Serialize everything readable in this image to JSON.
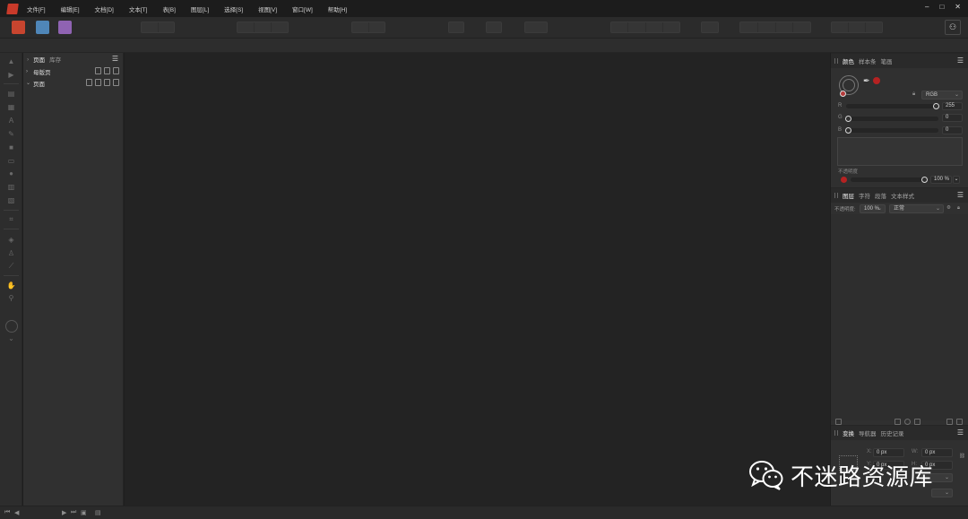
{
  "menubar": {
    "items": [
      "文件[F]",
      "编辑[E]",
      "文档[D]",
      "文本[T]",
      "表[B]",
      "图层[L]",
      "选择[S]",
      "视图[V]",
      "窗口[W]",
      "帮助[H]"
    ],
    "controls": [
      "–",
      "□",
      "✕"
    ]
  },
  "pages_panel": {
    "tabs": [
      "页面",
      "库存"
    ],
    "rows": [
      {
        "label": "母版页",
        "chevron": "›"
      },
      {
        "label": "页面",
        "chevron": "⌄"
      }
    ]
  },
  "colour_panel": {
    "tabs": [
      "颜色",
      "样本条",
      "笔画"
    ],
    "model": "RGB",
    "channels": [
      {
        "label": "R",
        "value": "255"
      },
      {
        "label": "G",
        "value": "0"
      },
      {
        "label": "B",
        "value": "0"
      }
    ],
    "opacity_label": "不透明度",
    "opacity_value": "100 %",
    "current_colour": "#b52222"
  },
  "layers_panel": {
    "tabs": [
      "图层",
      "字符",
      "段落",
      "文本样式"
    ],
    "opacity_label": "不透明度:",
    "opacity_value": "100 %",
    "blend_mode": "正常"
  },
  "transform_panel": {
    "tabs": [
      "变换",
      "导航器",
      "历史记录"
    ],
    "fields": [
      {
        "label": "X:",
        "value": "0 px"
      },
      {
        "label": "W:",
        "value": "0 px"
      },
      {
        "label": "Y:",
        "value": "0 px"
      },
      {
        "label": "H:",
        "value": "0 px"
      }
    ]
  },
  "watermark": {
    "text": "不迷路资源库"
  },
  "colors": {
    "accent": "#c83a2a"
  }
}
